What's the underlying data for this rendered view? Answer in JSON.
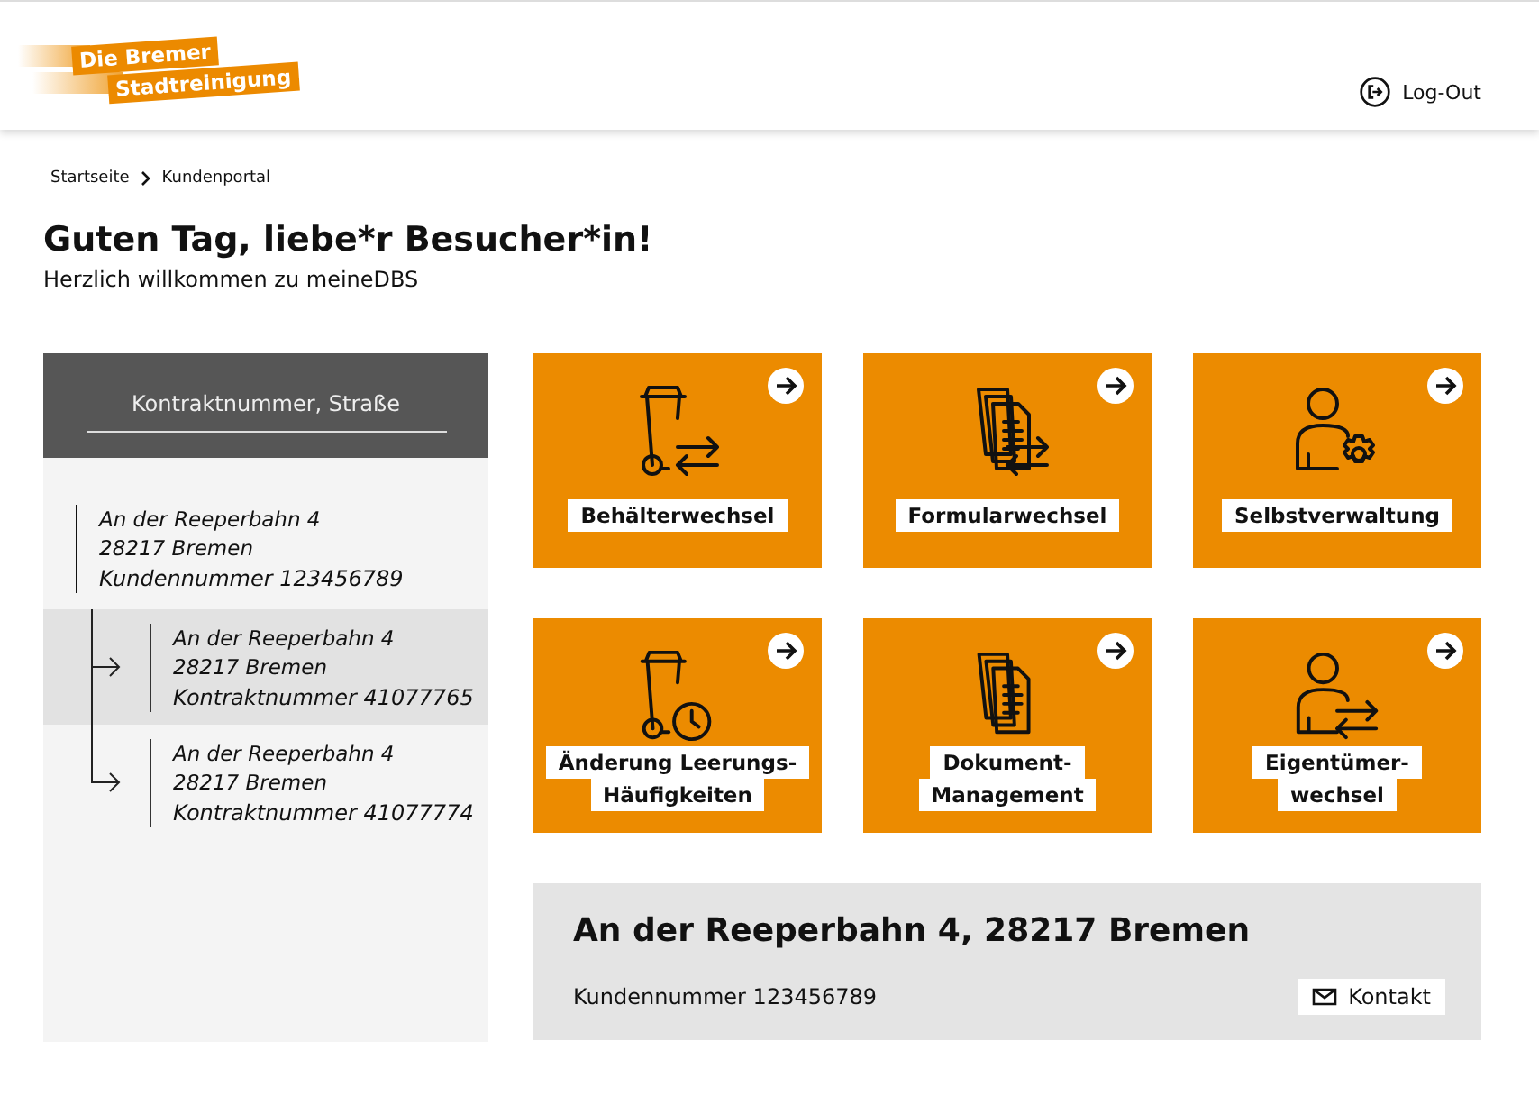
{
  "header": {
    "logo_lines": [
      "Die Bremer",
      "Stadtreinigung"
    ],
    "logout": "Log-Out"
  },
  "breadcrumb": [
    "Startseite",
    "Kundenportal"
  ],
  "greeting": {
    "title": "Guten Tag, liebe*r Besucher*in!",
    "subtitle": "Herzlich willkommen zu meineDBS"
  },
  "sidebar": {
    "search_placeholder": "Kontraktnummer, Straße",
    "customer": {
      "street": "An der Reeperbahn 4",
      "city": "28217 Bremen",
      "number": "Kundennummer 123456789",
      "selected": false,
      "children": [
        {
          "street": "An der Reeperbahn 4",
          "city": "28217 Bremen",
          "number": "Kontraktnummer 41077765",
          "selected": true
        },
        {
          "street": "An der Reeperbahn 4",
          "city": "28217 Bremen",
          "number": "Kontraktnummer 41077774",
          "selected": false
        }
      ]
    }
  },
  "tiles": [
    {
      "kind": "bin-swap",
      "label_lines": [
        "Behälterwechsel"
      ]
    },
    {
      "kind": "docs-swap",
      "label_lines": [
        "Formularwechsel"
      ]
    },
    {
      "kind": "user-gear",
      "label_lines": [
        "Selbstverwaltung"
      ]
    },
    {
      "kind": "bin-clock",
      "label_lines": [
        "Änderung Leerungs-",
        "Häufigkeiten"
      ]
    },
    {
      "kind": "docs",
      "label_lines": [
        "Dokument-",
        "Management"
      ]
    },
    {
      "kind": "user-swap",
      "label_lines": [
        "Eigentümer-",
        "wechsel"
      ]
    }
  ],
  "summary": {
    "title": "An der Reeperbahn 4, 28217 Bremen",
    "customer_number": "Kundennummer 123456789",
    "contact": "Kontakt"
  }
}
